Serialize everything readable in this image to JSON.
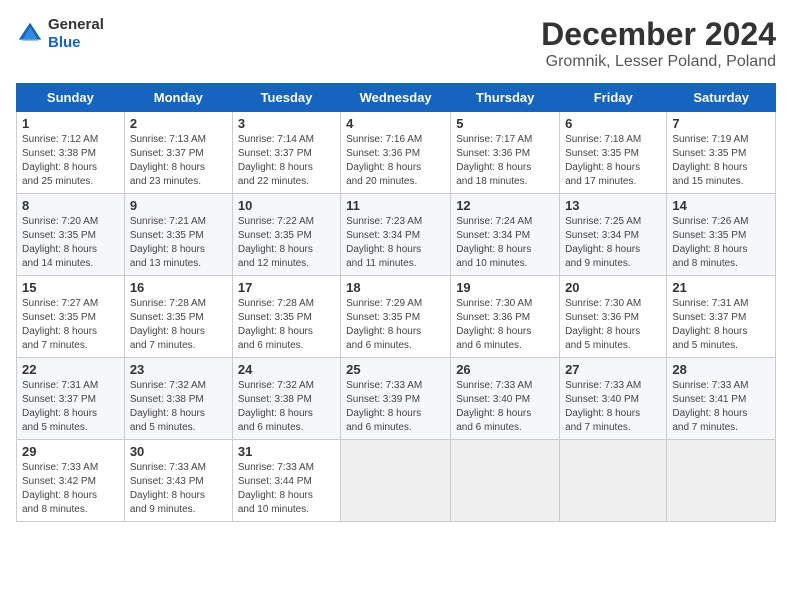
{
  "header": {
    "logo_line1": "General",
    "logo_line2": "Blue",
    "month_title": "December 2024",
    "location": "Gromnik, Lesser Poland, Poland"
  },
  "weekdays": [
    "Sunday",
    "Monday",
    "Tuesday",
    "Wednesday",
    "Thursday",
    "Friday",
    "Saturday"
  ],
  "weeks": [
    [
      {
        "day": "1",
        "sunrise": "7:12 AM",
        "sunset": "3:38 PM",
        "daylight": "8 hours and 25 minutes."
      },
      {
        "day": "2",
        "sunrise": "7:13 AM",
        "sunset": "3:37 PM",
        "daylight": "8 hours and 23 minutes."
      },
      {
        "day": "3",
        "sunrise": "7:14 AM",
        "sunset": "3:37 PM",
        "daylight": "8 hours and 22 minutes."
      },
      {
        "day": "4",
        "sunrise": "7:16 AM",
        "sunset": "3:36 PM",
        "daylight": "8 hours and 20 minutes."
      },
      {
        "day": "5",
        "sunrise": "7:17 AM",
        "sunset": "3:36 PM",
        "daylight": "8 hours and 18 minutes."
      },
      {
        "day": "6",
        "sunrise": "7:18 AM",
        "sunset": "3:35 PM",
        "daylight": "8 hours and 17 minutes."
      },
      {
        "day": "7",
        "sunrise": "7:19 AM",
        "sunset": "3:35 PM",
        "daylight": "8 hours and 15 minutes."
      }
    ],
    [
      {
        "day": "8",
        "sunrise": "7:20 AM",
        "sunset": "3:35 PM",
        "daylight": "8 hours and 14 minutes."
      },
      {
        "day": "9",
        "sunrise": "7:21 AM",
        "sunset": "3:35 PM",
        "daylight": "8 hours and 13 minutes."
      },
      {
        "day": "10",
        "sunrise": "7:22 AM",
        "sunset": "3:35 PM",
        "daylight": "8 hours and 12 minutes."
      },
      {
        "day": "11",
        "sunrise": "7:23 AM",
        "sunset": "3:34 PM",
        "daylight": "8 hours and 11 minutes."
      },
      {
        "day": "12",
        "sunrise": "7:24 AM",
        "sunset": "3:34 PM",
        "daylight": "8 hours and 10 minutes."
      },
      {
        "day": "13",
        "sunrise": "7:25 AM",
        "sunset": "3:34 PM",
        "daylight": "8 hours and 9 minutes."
      },
      {
        "day": "14",
        "sunrise": "7:26 AM",
        "sunset": "3:35 PM",
        "daylight": "8 hours and 8 minutes."
      }
    ],
    [
      {
        "day": "15",
        "sunrise": "7:27 AM",
        "sunset": "3:35 PM",
        "daylight": "8 hours and 7 minutes."
      },
      {
        "day": "16",
        "sunrise": "7:28 AM",
        "sunset": "3:35 PM",
        "daylight": "8 hours and 7 minutes."
      },
      {
        "day": "17",
        "sunrise": "7:28 AM",
        "sunset": "3:35 PM",
        "daylight": "8 hours and 6 minutes."
      },
      {
        "day": "18",
        "sunrise": "7:29 AM",
        "sunset": "3:35 PM",
        "daylight": "8 hours and 6 minutes."
      },
      {
        "day": "19",
        "sunrise": "7:30 AM",
        "sunset": "3:36 PM",
        "daylight": "8 hours and 6 minutes."
      },
      {
        "day": "20",
        "sunrise": "7:30 AM",
        "sunset": "3:36 PM",
        "daylight": "8 hours and 5 minutes."
      },
      {
        "day": "21",
        "sunrise": "7:31 AM",
        "sunset": "3:37 PM",
        "daylight": "8 hours and 5 minutes."
      }
    ],
    [
      {
        "day": "22",
        "sunrise": "7:31 AM",
        "sunset": "3:37 PM",
        "daylight": "8 hours and 5 minutes."
      },
      {
        "day": "23",
        "sunrise": "7:32 AM",
        "sunset": "3:38 PM",
        "daylight": "8 hours and 5 minutes."
      },
      {
        "day": "24",
        "sunrise": "7:32 AM",
        "sunset": "3:38 PM",
        "daylight": "8 hours and 6 minutes."
      },
      {
        "day": "25",
        "sunrise": "7:33 AM",
        "sunset": "3:39 PM",
        "daylight": "8 hours and 6 minutes."
      },
      {
        "day": "26",
        "sunrise": "7:33 AM",
        "sunset": "3:40 PM",
        "daylight": "8 hours and 6 minutes."
      },
      {
        "day": "27",
        "sunrise": "7:33 AM",
        "sunset": "3:40 PM",
        "daylight": "8 hours and 7 minutes."
      },
      {
        "day": "28",
        "sunrise": "7:33 AM",
        "sunset": "3:41 PM",
        "daylight": "8 hours and 7 minutes."
      }
    ],
    [
      {
        "day": "29",
        "sunrise": "7:33 AM",
        "sunset": "3:42 PM",
        "daylight": "8 hours and 8 minutes."
      },
      {
        "day": "30",
        "sunrise": "7:33 AM",
        "sunset": "3:43 PM",
        "daylight": "8 hours and 9 minutes."
      },
      {
        "day": "31",
        "sunrise": "7:33 AM",
        "sunset": "3:44 PM",
        "daylight": "8 hours and 10 minutes."
      },
      null,
      null,
      null,
      null
    ]
  ]
}
